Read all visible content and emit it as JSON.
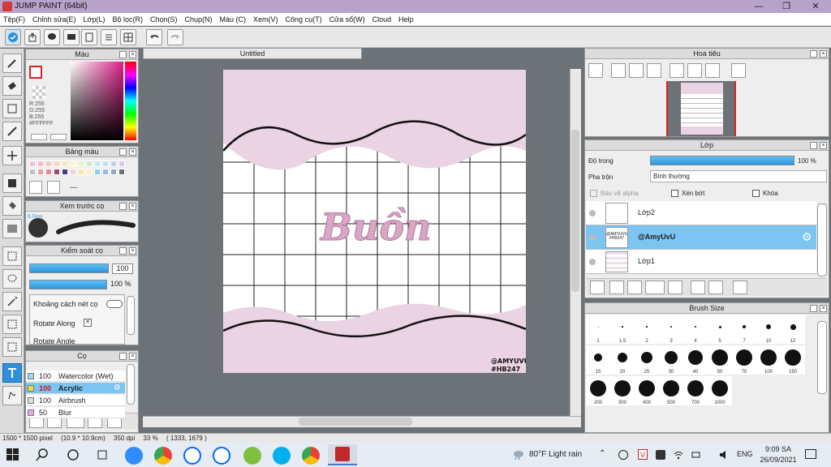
{
  "window": {
    "title": "JUMP PAINT (64bit)",
    "minimize": "—",
    "restore": "❐",
    "close": "✕"
  },
  "menu": [
    "Tệp(F)",
    "Chỉnh sửa(E)",
    "Lớp(L)",
    "Bộ lọc(R)",
    "Chọn(S)",
    "Chụp(N)",
    "Màu (C)",
    "Xem(V)",
    "Công cụ(T)",
    "Cửa sổ(W)",
    "Cloud",
    "Help"
  ],
  "color_panel": {
    "title": "Màu",
    "r": "R:255",
    "g": "G:255",
    "b": "B:255",
    "hex": "#FFFFFF"
  },
  "palette_panel": {
    "title": "Bảng màu",
    "dash": "---",
    "colors": [
      "#f5c1d6",
      "#f7b7c8",
      "#f9c6c6",
      "#fbd3c0",
      "#fde4bc",
      "#fff4c2",
      "#e4f4c6",
      "#ccecd0",
      "#c6e8e8",
      "#c4dcf2",
      "#c8cbee",
      "#d8c8ee",
      "#c0c0c0",
      "#e8a0a0",
      "#e88a9a",
      "#9a4a6a",
      "#4a3a8a",
      "#f2d0d8",
      "#f7e8a8",
      "#f6eec8",
      "#8ad0e8",
      "#9ab8e8",
      "#9aa0d0",
      "#707070"
    ]
  },
  "brush_preview_panel": {
    "title": "Xem trước cọ",
    "size": "9.7mm"
  },
  "brush_control_panel": {
    "title": "Kiểm soát cọ",
    "size_value": "100",
    "opacity_value": "100 %",
    "spacing_label": "Khoảng cách nét cọ",
    "rotate_label": "Rotate Along",
    "rotate_angle_label": "Rotate Angle",
    "rotate_checkbox": "✕"
  },
  "brush_panel": {
    "title": "Cọ",
    "items": [
      {
        "size": "100",
        "name": "Watercolor (Wet)",
        "color": "#9fd8f5"
      },
      {
        "size": "100",
        "name": "Acrylic",
        "color": "#f0e030"
      },
      {
        "size": "100",
        "name": "Airbrush",
        "color": "#dddddd"
      },
      {
        "size": "50",
        "name": "Blur",
        "color": "#e8a8e8"
      }
    ]
  },
  "document": {
    "tab": "Untitled",
    "text": "Buồn",
    "watermark_1": "@AMYUVU",
    "watermark_2": "#HB247"
  },
  "status": {
    "size": "1500 * 1500 pixel",
    "physical": "(10.9 * 10.9cm)",
    "dpi": "350 dpi",
    "zoom": "33 %",
    "coords": "( 1333, 1679 )"
  },
  "navigator_panel": {
    "title": "Hoa tiêu"
  },
  "layer_panel": {
    "title": "Lớp",
    "opacity_label": "Độ trong",
    "opacity_value": "100 %",
    "opacity_fraction": 1.0,
    "blend_label": "Pha trộn",
    "blend_value": "Bình thường",
    "protect_alpha": "Bảo vệ alpha",
    "clipping": "Xén bớt",
    "lock": "Khóa",
    "layers": [
      {
        "name": "Lớp2",
        "selected": false,
        "thumb": ""
      },
      {
        "name": "@AmyUvU",
        "selected": true,
        "thumb": "@AMYUVU #HB247"
      },
      {
        "name": "Lớp1",
        "selected": false,
        "thumb": ""
      }
    ]
  },
  "brush_size_panel": {
    "title": "Brush Size",
    "sizes": [
      "1",
      "1.5",
      "2",
      "3",
      "4",
      "5",
      "7",
      "10",
      "12",
      "15",
      "20",
      "25",
      "30",
      "40",
      "50",
      "70",
      "100",
      "150",
      "200",
      "300",
      "400",
      "500",
      "700",
      "1000"
    ]
  },
  "taskbar": {
    "weather": "80°F  Light rain",
    "lang": "ENG",
    "time": "9:09 SA",
    "date": "26/09/2021"
  }
}
